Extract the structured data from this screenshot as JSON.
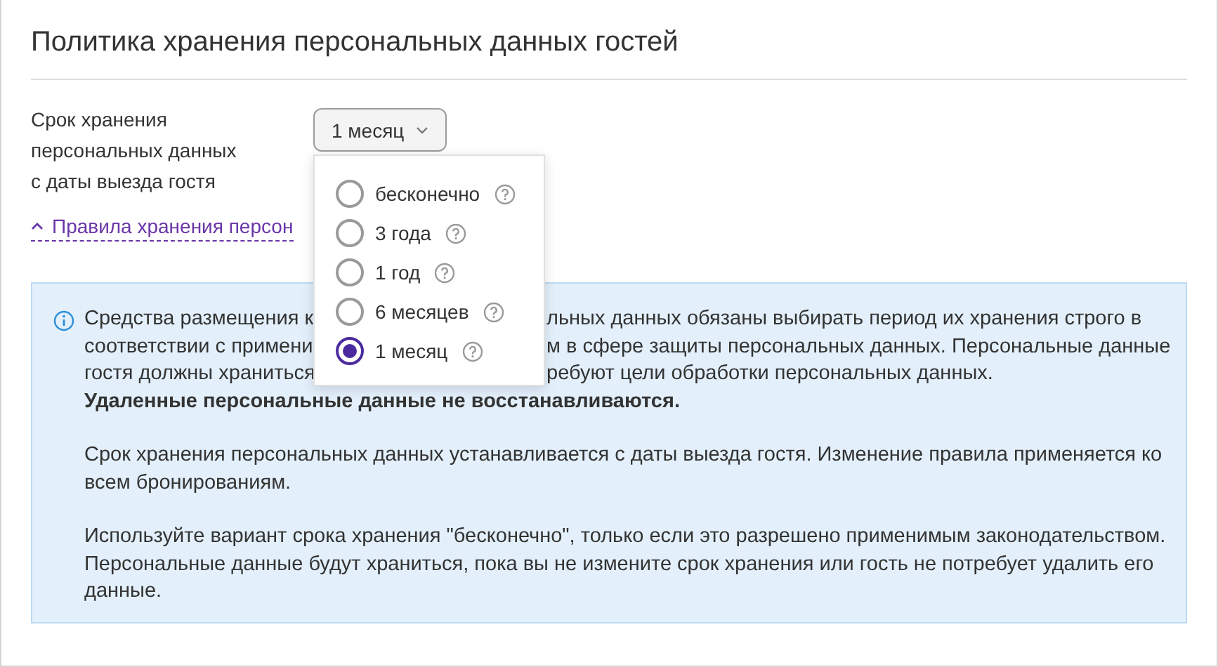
{
  "title": "Политика хранения персональных данных гостей",
  "retention": {
    "label": "Срок хранения персональных данных с даты выезда гостя",
    "select": {
      "value": "1 месяц",
      "expanded": true
    },
    "options": [
      {
        "label": "бесконечно",
        "selected": false
      },
      {
        "label": "3 года",
        "selected": false
      },
      {
        "label": "1 год",
        "selected": false
      },
      {
        "label": "6 месяцев",
        "selected": false
      },
      {
        "label": "1 месяц",
        "selected": true
      }
    ]
  },
  "rules_link": {
    "text": "Правила хранения персон",
    "expanded": true
  },
  "info": {
    "lines": [
      {
        "left": "Средства размещения к",
        "right": "льных данных обязаны выбирать период их хранения строго в"
      },
      {
        "left": "соответствии с примени",
        "right": "м в сфере защиты персональных данных. Персональные данные"
      },
      {
        "left": "гостя должны храниться",
        "right": "ребуют цели обработки персональных данных."
      }
    ],
    "note": "Удаленные персональные данные не восстанавливаются.",
    "paragraphs": [
      "Срок хранения персональных данных устанавливается с даты выезда гостя. Изменение правила применяется ко всем бронированиям.",
      "Используйте вариант срока хранения \"бесконечно\", только если это разрешено применимым законодательством. Персональные данные будут храниться, пока вы не измените срок хранения или гость не потребует удалить его данные."
    ]
  }
}
